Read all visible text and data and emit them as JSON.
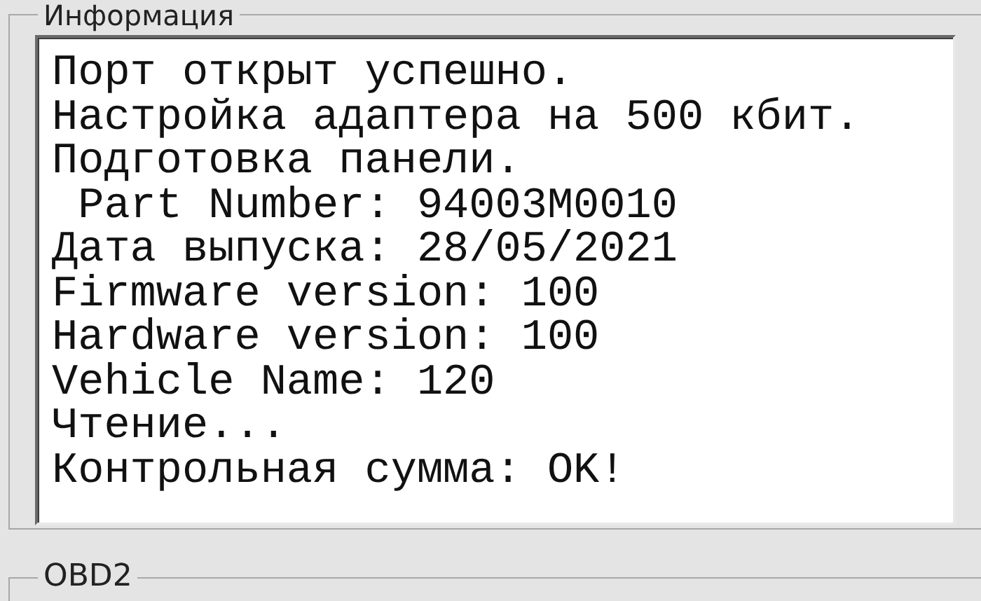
{
  "info_group": {
    "title": "Информация",
    "log_lines": [
      "Порт открыт успешно.",
      "Настройка адаптера на 500 кбит.",
      "Подготовка панели.",
      " Part Number: 94003M0010",
      "Дата выпуска: 28/05/2021",
      "Firmware version: 100",
      "Hardware version: 100",
      "Vehicle Name: 120",
      "Чтение...",
      "Контрольная сумма: OK!"
    ]
  },
  "obd2_group": {
    "title": "OBD2"
  }
}
